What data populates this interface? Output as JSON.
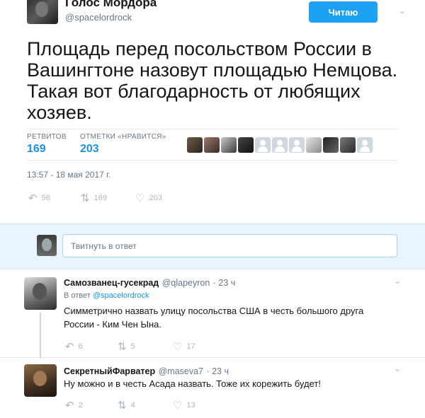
{
  "tweet": {
    "author_name": "Голос Мордора",
    "author_handle": "@spacelordrock",
    "follow_label": "Читаю",
    "text": "Площадь перед посольством России в Вашингтоне назовут площадью Немцова. Такая вот благодарность от любящих хозяев.",
    "retweets_label": "РЕТВИТОВ",
    "retweets_count": "169",
    "likes_label": "ОТМЕТКИ «НРАВИТСЯ»",
    "likes_count": "203",
    "date": "13:57 - 18 мая 2017 г.",
    "actions": {
      "reply": "56",
      "retweet": "169",
      "like": "203"
    }
  },
  "reply_box": {
    "placeholder": "Твитнуть в ответ"
  },
  "replies": [
    {
      "name": "Самозванец-гусекрад",
      "handle": "@qlapeyron",
      "time": "· 23 ч",
      "in_reply_prefix": "В ответ",
      "in_reply_to": "@spacelordrock",
      "text": "Симметрично назвать улицу посольства США в честь большого друга России - Ким Чен Ына.",
      "actions": {
        "reply": "6",
        "retweet": "5",
        "like": "17"
      }
    },
    {
      "name": "СекретныйФарватер",
      "handle": "@maseva7",
      "time": "· 23 ч",
      "text": "Ну можно и в честь Асада назвать. Тоже их корежить будет!",
      "actions": {
        "reply": "2",
        "retweet": "4",
        "like": "13"
      }
    }
  ],
  "icons": {
    "reply": "reply-icon",
    "retweet": "retweet-icon",
    "like": "heart-icon",
    "caret": "chevron-down-icon"
  },
  "colors": {
    "accent": "#1da1f2",
    "link": "#1b95e0",
    "band": "#e8f5fd"
  }
}
